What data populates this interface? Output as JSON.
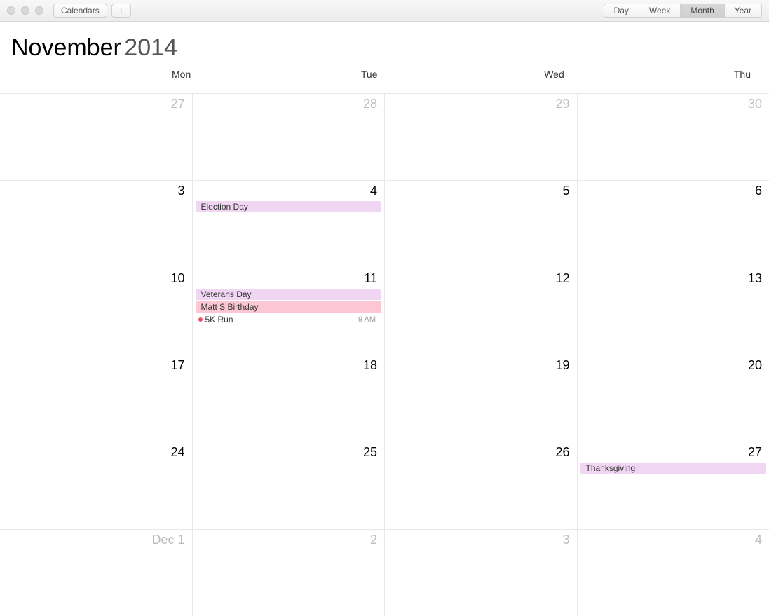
{
  "toolbar": {
    "calendars_button": "Calendars",
    "add_button": "+",
    "views": [
      "Day",
      "Week",
      "Month",
      "Year"
    ],
    "active_view": 2
  },
  "header": {
    "month": "November",
    "year": "2014"
  },
  "dow": [
    "Mon",
    "Tue",
    "Wed",
    "Thu"
  ],
  "colors": {
    "holiday": "#f0d6f2",
    "birthday": "#fcc6d4",
    "dot": "#e8526e"
  },
  "weeks": [
    {
      "days": [
        {
          "label": "27",
          "other": true,
          "events": []
        },
        {
          "label": "28",
          "other": true,
          "events": []
        },
        {
          "label": "29",
          "other": true,
          "events": []
        },
        {
          "label": "30",
          "other": true,
          "events": []
        }
      ]
    },
    {
      "days": [
        {
          "label": "3",
          "other": false,
          "events": []
        },
        {
          "label": "4",
          "other": false,
          "events": [
            {
              "title": "Election Day",
              "colorKey": "holiday"
            }
          ]
        },
        {
          "label": "5",
          "other": false,
          "events": []
        },
        {
          "label": "6",
          "other": false,
          "events": []
        }
      ]
    },
    {
      "days": [
        {
          "label": "10",
          "other": false,
          "events": []
        },
        {
          "label": "11",
          "other": false,
          "events": [
            {
              "title": "Veterans Day",
              "colorKey": "holiday"
            },
            {
              "title": "Matt S Birthday",
              "colorKey": "birthday"
            },
            {
              "title": "5K Run",
              "time": "9 AM",
              "timed": true,
              "dotKey": "dot"
            }
          ]
        },
        {
          "label": "12",
          "other": false,
          "events": []
        },
        {
          "label": "13",
          "other": false,
          "events": []
        }
      ]
    },
    {
      "days": [
        {
          "label": "17",
          "other": false,
          "events": []
        },
        {
          "label": "18",
          "other": false,
          "events": []
        },
        {
          "label": "19",
          "other": false,
          "events": []
        },
        {
          "label": "20",
          "other": false,
          "events": []
        }
      ]
    },
    {
      "days": [
        {
          "label": "24",
          "other": false,
          "events": []
        },
        {
          "label": "25",
          "other": false,
          "events": []
        },
        {
          "label": "26",
          "other": false,
          "events": []
        },
        {
          "label": "27",
          "other": false,
          "events": [
            {
              "title": "Thanksgiving",
              "colorKey": "holiday"
            }
          ]
        }
      ]
    },
    {
      "days": [
        {
          "label": "Dec 1",
          "other": true,
          "events": []
        },
        {
          "label": "2",
          "other": true,
          "events": []
        },
        {
          "label": "3",
          "other": true,
          "events": []
        },
        {
          "label": "4",
          "other": true,
          "events": []
        }
      ]
    }
  ]
}
